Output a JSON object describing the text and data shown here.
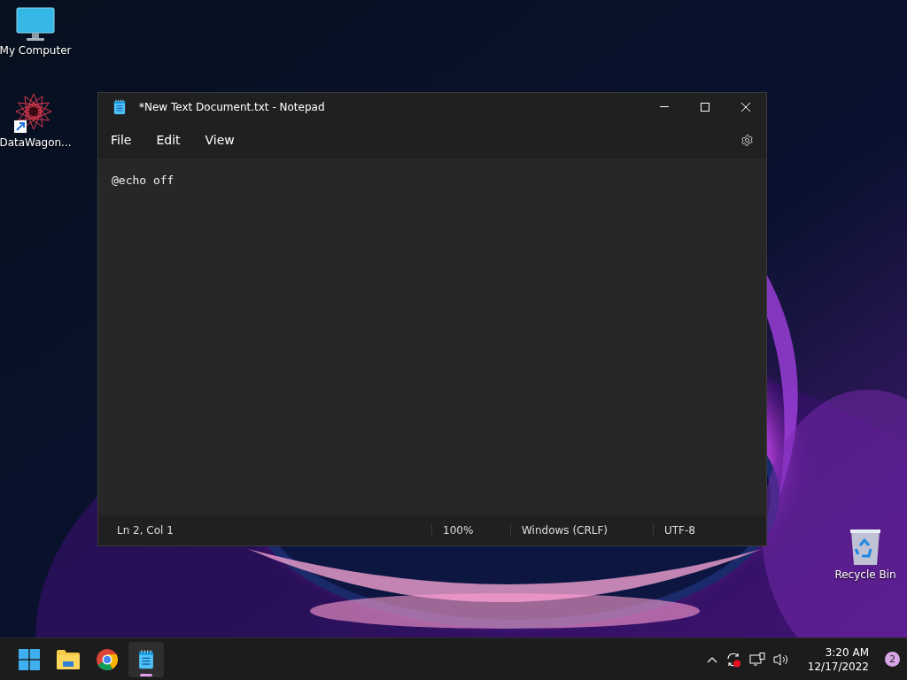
{
  "desktop_icons": [
    {
      "label": "My Computer",
      "kind": "computer"
    },
    {
      "label": "DataWagon...",
      "kind": "shortcut"
    },
    {
      "label": "Recycle Bin",
      "kind": "recycle"
    }
  ],
  "window": {
    "title": "*New Text Document.txt - Notepad",
    "menu": [
      "File",
      "Edit",
      "View"
    ],
    "content": "@echo off",
    "status_bar": [
      "Ln 2, Col 1",
      "100%",
      "Windows (CRLF)",
      "UTF-8"
    ]
  },
  "taskbar": {
    "apps": [
      {
        "kind": "start",
        "selected": false
      },
      {
        "kind": "folder",
        "selected": false
      },
      {
        "kind": "browser",
        "selected": false
      },
      {
        "kind": "notepad",
        "selected": true
      }
    ],
    "time": "3:20 AM",
    "date": "12/17/2022",
    "notification_count": "2"
  }
}
